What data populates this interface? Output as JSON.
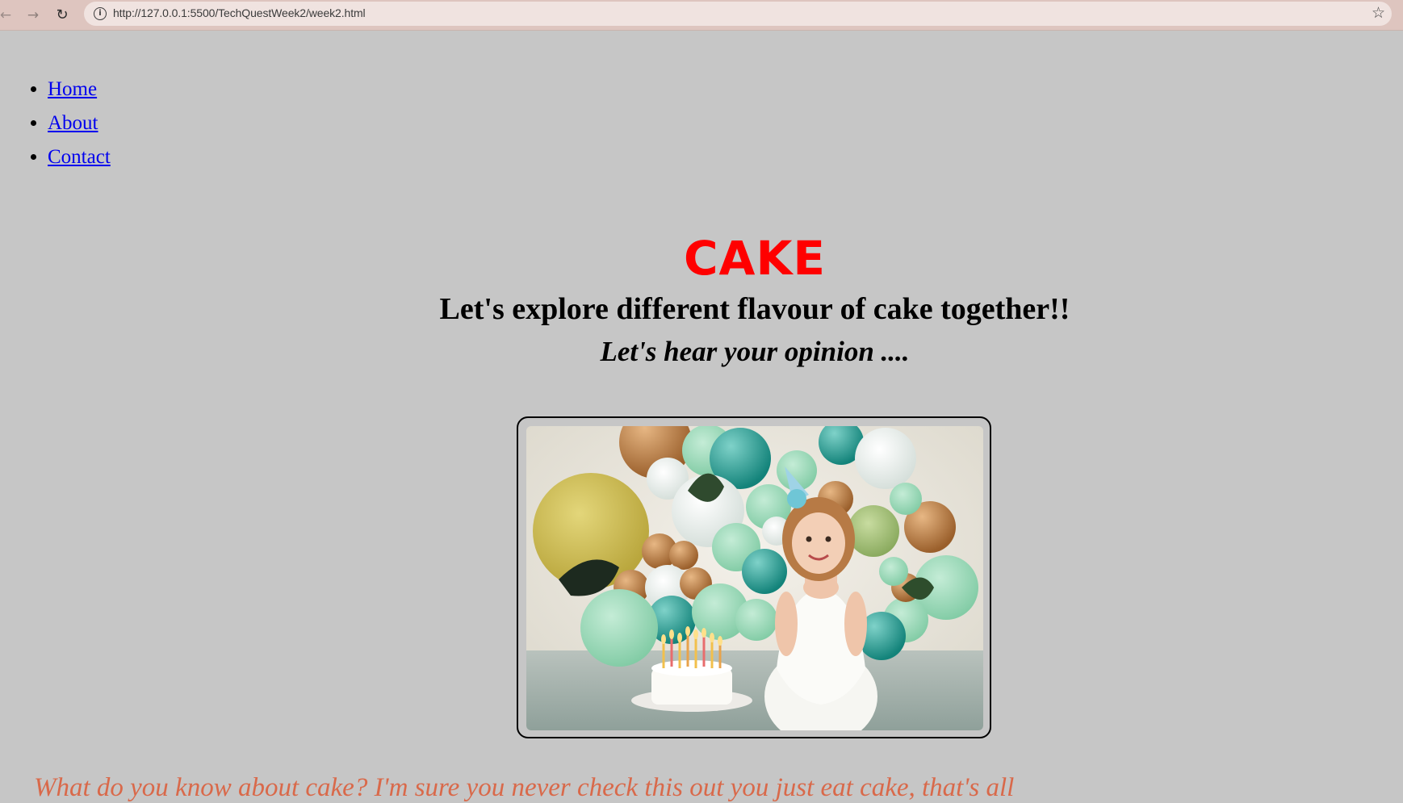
{
  "browser": {
    "url": "http://127.0.0.1:5500/TechQuestWeek2/week2.html",
    "back_icon": "arrow-left",
    "forward_icon": "arrow-right",
    "reload_icon": "reload",
    "info_icon": "info",
    "bookmark_icon": "star"
  },
  "nav": {
    "items": [
      {
        "label": "Home"
      },
      {
        "label": "About"
      },
      {
        "label": "Contact"
      }
    ]
  },
  "hero": {
    "title": "CAKE",
    "subtitle": "Let's explore different flavour of cake together!!",
    "tagline": "Let's hear your opinion ...."
  },
  "intro": {
    "text": "What do you know about cake? I'm sure you never check this out you just eat cake, that's all"
  },
  "colors": {
    "page_background": "#c6c6c6",
    "title": "#ff0000",
    "link": "#0000ee",
    "intro_text": "#d9694a"
  }
}
